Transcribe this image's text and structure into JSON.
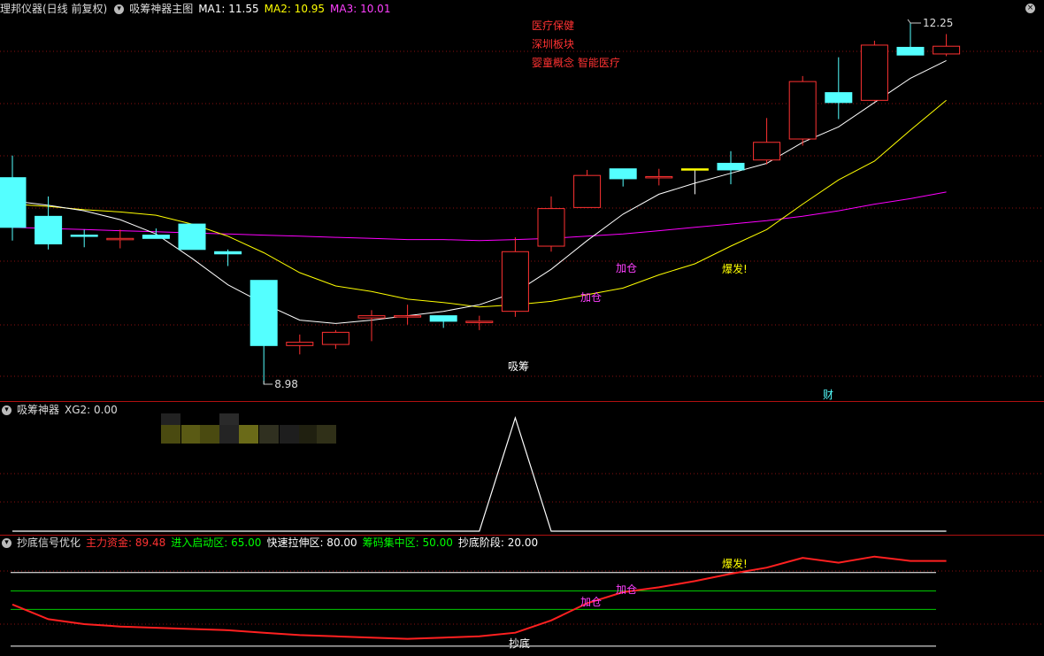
{
  "main": {
    "title": "理邦仪器(日线 前复权)",
    "indicator": "吸筹神器主图",
    "ma1": "MA1: 11.55",
    "ma2": "MA2: 10.95",
    "ma3": "MA3: 10.01",
    "tags": [
      "医疗保健",
      "深圳板块",
      "婴童概念 智能医疗"
    ],
    "high_label": "12.25",
    "low_label": "8.98",
    "marks": {
      "xichou": "吸筹",
      "jiacang1": "加仓",
      "jiacang2": "加仓",
      "baofa": "爆发!",
      "cai": "财"
    },
    "colors": {
      "up": "#ff3232",
      "down": "#54ffff",
      "ma1": "#ffffff",
      "ma2": "#ffff00",
      "ma3": "#ff00ff"
    }
  },
  "panel2": {
    "title": "吸筹神器",
    "xg2": "XG2: 0.00"
  },
  "panel3": {
    "title": "抄底信号优化",
    "items": [
      {
        "label": "主力资金: 89.48",
        "color": "#ff3232"
      },
      {
        "label": "进入启动区: 65.00",
        "color": "#00ff00"
      },
      {
        "label": "快速拉伸区: 80.00",
        "color": "#ffffff"
      },
      {
        "label": "筹码集中区: 50.00",
        "color": "#00ff00"
      },
      {
        "label": "抄底阶段: 20.00",
        "color": "#ffffff"
      }
    ],
    "marks": {
      "chaodi": "抄底",
      "jiacang1": "加仓",
      "jiacang2": "加仓",
      "baofa": "爆发!"
    }
  },
  "chart_data": [
    {
      "type": "candlestick",
      "title": "理邦仪器(日线 前复权)",
      "y_range": [
        8.98,
        12.25
      ],
      "candles": [
        {
          "o": 10.85,
          "h": 11.05,
          "c": 10.4,
          "l": 10.28
        },
        {
          "o": 10.5,
          "h": 10.68,
          "c": 10.25,
          "l": 10.2
        },
        {
          "o": 10.33,
          "h": 10.38,
          "c": 10.32,
          "l": 10.22
        },
        {
          "o": 10.3,
          "h": 10.38,
          "c": 10.3,
          "l": 10.21
        },
        {
          "o": 10.33,
          "h": 10.39,
          "c": 10.3,
          "l": 10.31
        },
        {
          "o": 10.43,
          "h": 10.43,
          "c": 10.2,
          "l": 10.2
        },
        {
          "o": 10.18,
          "h": 10.2,
          "c": 10.16,
          "l": 10.05
        },
        {
          "o": 9.92,
          "h": 9.92,
          "c": 9.33,
          "l": 8.98
        },
        {
          "o": 9.33,
          "h": 9.43,
          "c": 9.36,
          "l": 9.25
        },
        {
          "o": 9.34,
          "h": 9.47,
          "c": 9.45,
          "l": 9.3
        },
        {
          "o": 9.58,
          "h": 9.65,
          "c": 9.6,
          "l": 9.37
        },
        {
          "o": 9.6,
          "h": 9.7,
          "c": 9.6,
          "l": 9.52
        },
        {
          "o": 9.6,
          "h": 9.6,
          "c": 9.55,
          "l": 9.49
        },
        {
          "o": 9.55,
          "h": 9.6,
          "c": 9.55,
          "l": 9.47
        },
        {
          "o": 9.64,
          "h": 10.31,
          "c": 10.18,
          "l": 9.59
        },
        {
          "o": 10.23,
          "h": 10.68,
          "c": 10.57,
          "l": 10.18
        },
        {
          "o": 10.58,
          "h": 10.92,
          "c": 10.87,
          "l": 10.58
        },
        {
          "o": 10.93,
          "h": 10.93,
          "c": 10.84,
          "l": 10.77
        },
        {
          "o": 10.86,
          "h": 10.93,
          "c": 10.86,
          "l": 10.78
        },
        {
          "o": 10.93,
          "h": 10.93,
          "c": 10.93,
          "l": 10.7
        },
        {
          "o": 10.98,
          "h": 11.09,
          "c": 10.92,
          "l": 10.79
        },
        {
          "o": 11.01,
          "h": 11.39,
          "c": 11.17,
          "l": 10.97
        },
        {
          "o": 11.2,
          "h": 11.77,
          "c": 11.72,
          "l": 11.14
        },
        {
          "o": 11.62,
          "h": 11.94,
          "c": 11.53,
          "l": 11.38
        },
        {
          "o": 11.55,
          "h": 12.09,
          "c": 12.05,
          "l": 11.54
        },
        {
          "o": 12.03,
          "h": 12.25,
          "c": 11.96,
          "l": 11.96
        },
        {
          "o": 11.97,
          "h": 12.15,
          "c": 12.04,
          "l": 11.95
        }
      ],
      "ma1": [
        10.64,
        10.6,
        10.55,
        10.47,
        10.34,
        10.12,
        9.88,
        9.71,
        9.56,
        9.53,
        9.56,
        9.6,
        9.64,
        9.7,
        9.81,
        10.02,
        10.28,
        10.52,
        10.7,
        10.8,
        10.89,
        10.98,
        11.17,
        11.31,
        11.53,
        11.75,
        11.91
      ],
      "ma2": [
        10.61,
        10.59,
        10.56,
        10.54,
        10.51,
        10.43,
        10.32,
        10.17,
        9.99,
        9.87,
        9.82,
        9.75,
        9.72,
        9.68,
        9.7,
        9.73,
        9.79,
        9.85,
        9.97,
        10.07,
        10.23,
        10.38,
        10.61,
        10.83,
        11.0,
        11.28,
        11.55
      ],
      "ma3": [
        10.4,
        10.39,
        10.38,
        10.37,
        10.36,
        10.35,
        10.34,
        10.33,
        10.32,
        10.31,
        10.3,
        10.29,
        10.29,
        10.28,
        10.29,
        10.3,
        10.32,
        10.34,
        10.37,
        10.4,
        10.43,
        10.46,
        10.5,
        10.55,
        10.61,
        10.66,
        10.72
      ]
    },
    {
      "type": "line",
      "title": "吸筹神器",
      "series": [
        {
          "name": "XG2",
          "values": [
            0,
            0,
            0,
            0,
            0,
            0,
            0,
            0,
            0,
            0,
            0,
            0,
            0,
            0,
            1,
            0,
            0,
            0,
            0,
            0,
            0,
            0,
            0,
            0,
            0,
            0,
            0
          ]
        }
      ]
    },
    {
      "type": "line",
      "title": "抄底信号优化",
      "y_range": [
        12,
        100
      ],
      "levels": [
        20,
        50,
        65,
        80
      ],
      "series": [
        {
          "name": "主力资金",
          "values": [
            54,
            42,
            38,
            36,
            35,
            34,
            33,
            31,
            29,
            28,
            27,
            26,
            27,
            28,
            31,
            41,
            55,
            64,
            68,
            73,
            79,
            84,
            92,
            88,
            93,
            89.48,
            89.48
          ]
        }
      ]
    }
  ]
}
